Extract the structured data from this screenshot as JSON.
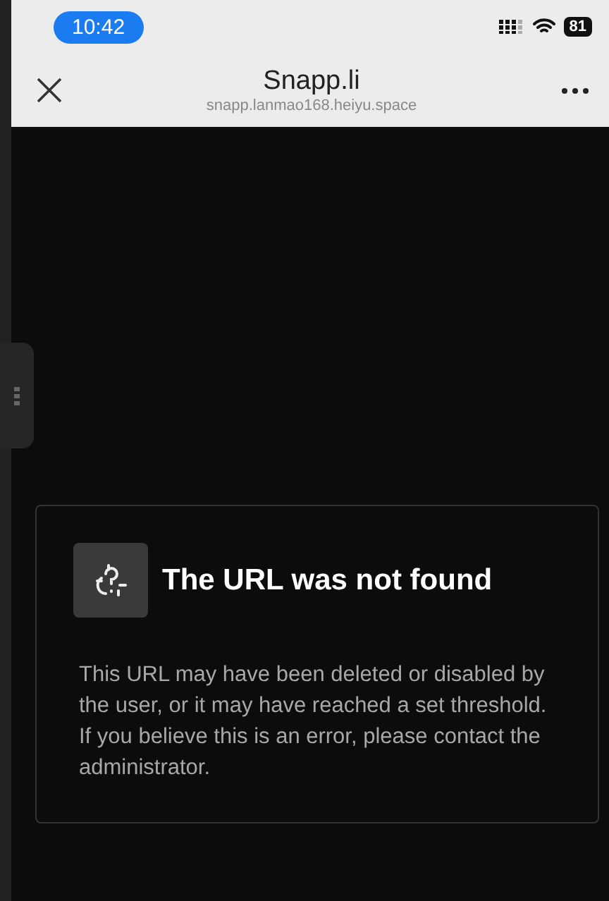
{
  "status_bar": {
    "time": "10:42",
    "battery": "81"
  },
  "nav": {
    "title": "Snapp.li",
    "url": "snapp.lanmao168.heiyu.space"
  },
  "error_card": {
    "title": "The URL was not found",
    "message": "This URL may have been deleted or disabled by the user, or it may have reached a set threshold. If you believe this is an error, please contact the administrator."
  }
}
